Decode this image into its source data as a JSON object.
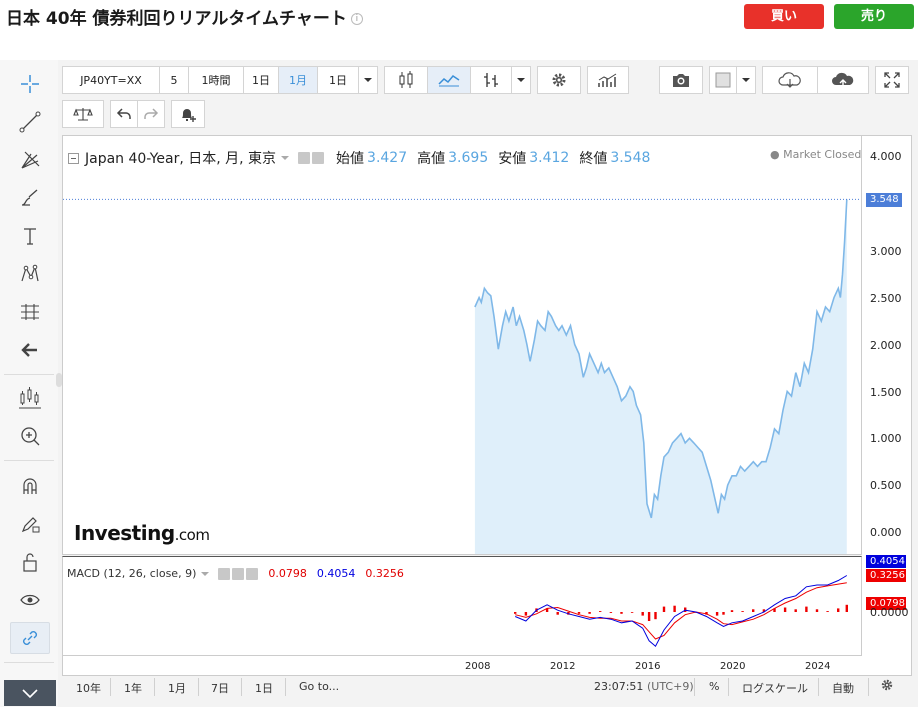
{
  "header": {
    "title": "日本 40年 債券利回りリアルタイムチャート",
    "info_icon": "i",
    "buy_label": "買い",
    "sell_label": "売り",
    "buy_color": "#e8312a",
    "sell_color": "#2ba52b"
  },
  "toolbar": {
    "symbol": "JP40YT=XX",
    "interval_5": "5",
    "interval_1h": "1時間",
    "interval_1d": "1日",
    "interval_1m": "1月",
    "interval_dropdown": "1日",
    "active_interval": "1月"
  },
  "legend": {
    "symbol_label": "Japan 40-Year, 日本, 月, 東京",
    "open_label": "始値",
    "open_value": "3.427",
    "high_label": "高値",
    "high_value": "3.695",
    "low_label": "安値",
    "low_value": "3.412",
    "close_label": "終値",
    "close_value": "3.548",
    "market_status": "Market Closed"
  },
  "macd": {
    "label": "MACD (12, 26, close, 9)",
    "hist_value": "0.0798",
    "macd_value": "0.4054",
    "signal_value": "0.3256"
  },
  "yaxis": {
    "ticks": [
      "4.000",
      "3.548",
      "3.000",
      "2.500",
      "2.000",
      "1.500",
      "1.000",
      "0.500",
      "0.000"
    ],
    "price_label": "3.548",
    "macd_labels": [
      "0.4054",
      "0.3256",
      "0.0798",
      "0.0000"
    ]
  },
  "xaxis": {
    "ticks": [
      "2008",
      "2012",
      "2016",
      "2020",
      "2024"
    ]
  },
  "watermark": {
    "brand": "Investing",
    "suffix": ".com"
  },
  "bottombar": {
    "ranges": [
      "10年",
      "1年",
      "1月",
      "7日",
      "1日"
    ],
    "goto": "Go to...",
    "clock": "23:07:51",
    "timezone": "(UTC+9)",
    "percent": "%",
    "log_scale": "ログスケール",
    "auto": "自動"
  },
  "chart_data": {
    "type": "area",
    "title": "Japan 40-Year, 日本, 月, 東京",
    "xlabel": "",
    "ylabel": "",
    "ylim": [
      -0.1,
      4.2
    ],
    "xlim": [
      2007.9,
      2026.8
    ],
    "line_color": "#7fb8e8",
    "fill_color": "#dfeffa",
    "grid": false,
    "x_ticks": [
      2008,
      2012,
      2016,
      2020,
      2024
    ],
    "y_ticks": [
      0,
      0.5,
      1.0,
      1.5,
      2.0,
      2.5,
      3.0,
      3.5,
      4.0
    ],
    "series": [
      {
        "x": [
          2007.9,
          2008.1,
          2008.2,
          2008.35,
          2008.5,
          2008.65,
          2008.8,
          2009.0,
          2009.2,
          2009.35,
          2009.5,
          2009.7,
          2009.85,
          2010.0,
          2010.2,
          2010.35,
          2010.5,
          2010.7,
          2010.85,
          2011.0,
          2011.2,
          2011.35,
          2011.5,
          2011.7,
          2011.85,
          2012.0,
          2012.2,
          2012.4,
          2012.6,
          2012.8,
          2013.0,
          2013.15,
          2013.3,
          2013.5,
          2013.7,
          2013.85,
          2014.0,
          2014.2,
          2014.4,
          2014.6,
          2014.8,
          2015.0,
          2015.2,
          2015.35,
          2015.5,
          2015.7,
          2015.85,
          2016.0,
          2016.2,
          2016.35,
          2016.5,
          2016.65,
          2016.8,
          2017.0,
          2017.2,
          2017.4,
          2017.6,
          2017.8,
          2018.0,
          2018.2,
          2018.4,
          2018.6,
          2018.8,
          2019.0,
          2019.2,
          2019.35,
          2019.5,
          2019.65,
          2019.8,
          2020.0,
          2020.2,
          2020.4,
          2020.6,
          2020.8,
          2021.0,
          2021.2,
          2021.4,
          2021.6,
          2021.8,
          2022.0,
          2022.2,
          2022.4,
          2022.6,
          2022.8,
          2023.0,
          2023.2,
          2023.4,
          2023.6,
          2023.8,
          2024.0,
          2024.2,
          2024.4,
          2024.6,
          2024.8,
          2025.0,
          2025.1,
          2025.2,
          2025.3,
          2025.4
        ],
        "y": [
          2.4,
          2.5,
          2.45,
          2.6,
          2.55,
          2.52,
          2.3,
          1.95,
          2.2,
          2.35,
          2.25,
          2.4,
          2.2,
          2.3,
          2.15,
          2.0,
          1.82,
          2.05,
          2.25,
          2.2,
          2.15,
          2.35,
          2.3,
          2.2,
          2.15,
          2.2,
          2.1,
          2.2,
          2.0,
          1.9,
          1.65,
          1.75,
          1.9,
          1.8,
          1.7,
          1.8,
          1.7,
          1.75,
          1.65,
          1.55,
          1.4,
          1.45,
          1.55,
          1.5,
          1.35,
          1.25,
          0.95,
          0.3,
          0.15,
          0.4,
          0.35,
          0.6,
          0.8,
          0.85,
          0.95,
          1.0,
          1.05,
          0.95,
          1.0,
          0.95,
          0.9,
          0.85,
          0.7,
          0.55,
          0.35,
          0.2,
          0.4,
          0.35,
          0.5,
          0.6,
          0.6,
          0.7,
          0.65,
          0.7,
          0.75,
          0.7,
          0.75,
          0.75,
          0.9,
          1.1,
          1.05,
          1.3,
          1.5,
          1.45,
          1.7,
          1.55,
          1.8,
          1.7,
          1.95,
          2.35,
          2.25,
          2.4,
          2.35,
          2.5,
          2.6,
          2.5,
          2.75,
          3.1,
          3.548
        ]
      }
    ]
  },
  "macd_data": {
    "type": "line",
    "ylim": [
      -0.45,
      0.5
    ],
    "macd_color": "#0000dd",
    "signal_color": "#ee0000",
    "hist_color": "#ee0000",
    "x": [
      2009.8,
      2010.3,
      2010.8,
      2011.3,
      2011.8,
      2012.3,
      2012.8,
      2013.3,
      2013.8,
      2014.3,
      2014.8,
      2015.3,
      2015.8,
      2016.1,
      2016.4,
      2016.8,
      2017.3,
      2017.8,
      2018.3,
      2018.8,
      2019.3,
      2019.6,
      2020.0,
      2020.5,
      2021.0,
      2021.5,
      2022.0,
      2022.5,
      2023.0,
      2023.5,
      2024.0,
      2024.5,
      2025.0,
      2025.4
    ],
    "macd": [
      -0.05,
      -0.1,
      0.02,
      0.08,
      0.02,
      -0.02,
      -0.05,
      -0.08,
      -0.06,
      -0.08,
      -0.12,
      -0.1,
      -0.18,
      -0.32,
      -0.38,
      -0.2,
      -0.05,
      0.02,
      0.0,
      -0.05,
      -0.12,
      -0.16,
      -0.12,
      -0.1,
      -0.05,
      0.0,
      0.08,
      0.15,
      0.18,
      0.28,
      0.3,
      0.3,
      0.35,
      0.4054
    ],
    "signal": [
      -0.03,
      -0.06,
      -0.02,
      0.04,
      0.05,
      0.01,
      -0.03,
      -0.06,
      -0.07,
      -0.07,
      -0.1,
      -0.1,
      -0.14,
      -0.22,
      -0.3,
      -0.26,
      -0.12,
      -0.03,
      0.0,
      -0.02,
      -0.08,
      -0.13,
      -0.14,
      -0.11,
      -0.08,
      -0.03,
      0.04,
      0.1,
      0.15,
      0.22,
      0.27,
      0.29,
      0.31,
      0.3256
    ],
    "hist": [
      -0.02,
      -0.04,
      0.04,
      0.04,
      -0.03,
      -0.03,
      -0.02,
      -0.02,
      0.01,
      -0.01,
      -0.02,
      0.0,
      -0.04,
      -0.1,
      -0.08,
      0.06,
      0.07,
      0.05,
      0.0,
      -0.03,
      -0.04,
      -0.03,
      0.02,
      0.01,
      0.03,
      0.03,
      0.04,
      0.05,
      0.03,
      0.06,
      0.03,
      0.01,
      0.04,
      0.0798
    ]
  }
}
